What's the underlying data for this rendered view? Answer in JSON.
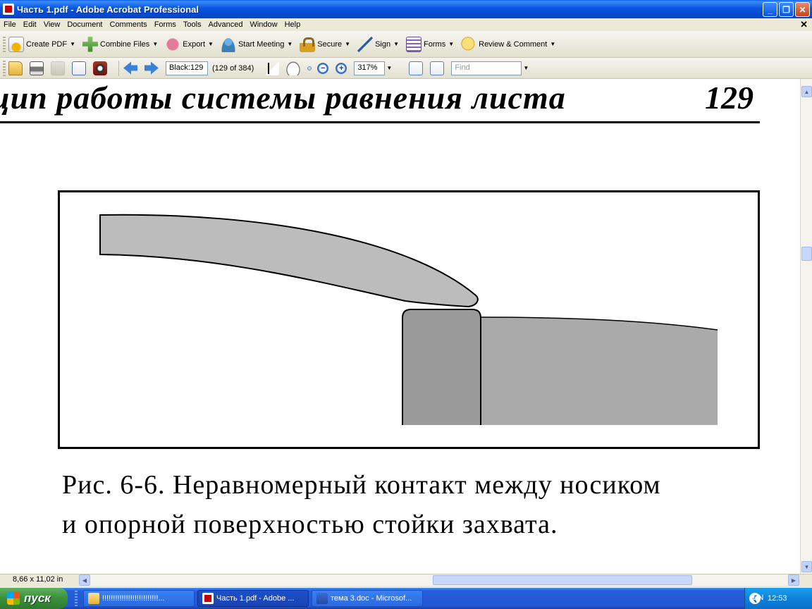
{
  "window": {
    "title": "Часть 1.pdf - Adobe Acrobat Professional"
  },
  "menu": [
    "File",
    "Edit",
    "View",
    "Document",
    "Comments",
    "Forms",
    "Tools",
    "Advanced",
    "Window",
    "Help"
  ],
  "toolbar1": {
    "create_pdf": "Create PDF",
    "combine_files": "Combine Files",
    "export": "Export",
    "start_meeting": "Start Meeting",
    "secure": "Secure",
    "sign": "Sign",
    "forms": "Forms",
    "review_comment": "Review & Comment"
  },
  "toolbar2": {
    "page_value": "Black:129",
    "page_count": "(129 of 384)",
    "zoom_value": "317%",
    "find_placeholder": "Find"
  },
  "document": {
    "running_head": "цип работы системы равнения листа",
    "page_number": "129",
    "caption_line1": "Рис. 6-6. Неравномерный контакт между носиком",
    "caption_line2": "и опорной поверхностью стойки захвата."
  },
  "status": {
    "page_size": "8,66 x 11,02 in"
  },
  "taskbar": {
    "start": "пуск",
    "tasks": [
      {
        "label": "!!!!!!!!!!!!!!!!!!!!!!!!!!...",
        "icon": "folder-icon"
      },
      {
        "label": "Часть 1.pdf - Adobe ...",
        "icon": "pdf-icon"
      },
      {
        "label": "тема 3.doc - Microsof...",
        "icon": "word-icon"
      }
    ],
    "lang": "EN",
    "clock": "12:53"
  }
}
